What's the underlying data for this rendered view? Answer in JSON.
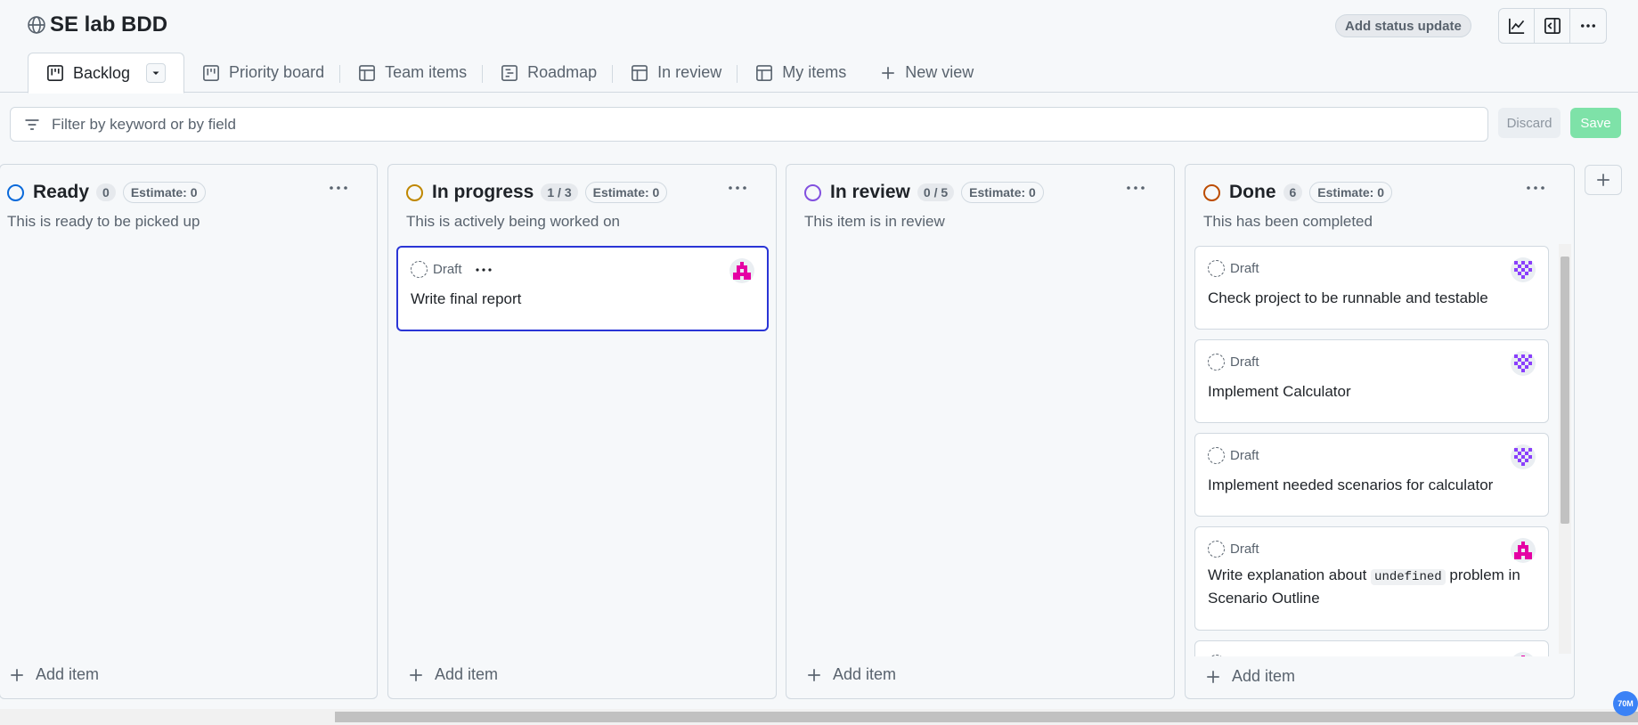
{
  "header": {
    "title": "SE lab BDD",
    "status_button": "Add status update"
  },
  "tabs": [
    {
      "label": "Backlog",
      "icon": "board-icon",
      "active": true
    },
    {
      "label": "Priority board",
      "icon": "board-icon"
    },
    {
      "label": "Team items",
      "icon": "table-icon"
    },
    {
      "label": "Roadmap",
      "icon": "roadmap-icon"
    },
    {
      "label": "In review",
      "icon": "table-icon"
    },
    {
      "label": "My items",
      "icon": "table-icon"
    },
    {
      "label": "New view",
      "icon": "plus-icon"
    }
  ],
  "filter": {
    "placeholder": "Filter by keyword or by field",
    "discard": "Discard",
    "save": "Save"
  },
  "columns": [
    {
      "name": "Ready",
      "count": "0",
      "estimate": "Estimate: 0",
      "description": "This is ready to be picked up",
      "color": "#0969da",
      "add_label": "Add item",
      "cards": []
    },
    {
      "name": "In progress",
      "count": "1 / 3",
      "estimate": "Estimate: 0",
      "description": "This is actively being worked on",
      "color": "#bf8700",
      "add_label": "Add item",
      "cards": [
        {
          "status": "Draft",
          "title": "Write final report",
          "avatar": "pink"
        }
      ]
    },
    {
      "name": "In review",
      "count": "0 / 5",
      "estimate": "Estimate: 0",
      "description": "This item is in review",
      "color": "#8250df",
      "add_label": "Add item",
      "cards": []
    },
    {
      "name": "Done",
      "count": "6",
      "estimate": "Estimate: 0",
      "description": "This has been completed",
      "color": "#bc4c00",
      "add_label": "Add item",
      "cards": [
        {
          "status": "Draft",
          "title": "Check project to be runnable and testable",
          "avatar": "purple"
        },
        {
          "status": "Draft",
          "title": "Implement Calculator",
          "avatar": "purple"
        },
        {
          "status": "Draft",
          "title": "Implement needed scenarios for calculator",
          "avatar": "purple"
        },
        {
          "status": "Draft",
          "title_before": "Write explanation about",
          "title_code": "undefined",
          "title_after": "problem in Scenario Outline",
          "avatar": "pink"
        }
      ]
    }
  ],
  "badge": "70M",
  "colors": {
    "accent_selected": "#2a35d6",
    "save_green": "#7ee2a8",
    "avatar_pink": "#e500a4",
    "avatar_purple": "#8a3ffc"
  }
}
